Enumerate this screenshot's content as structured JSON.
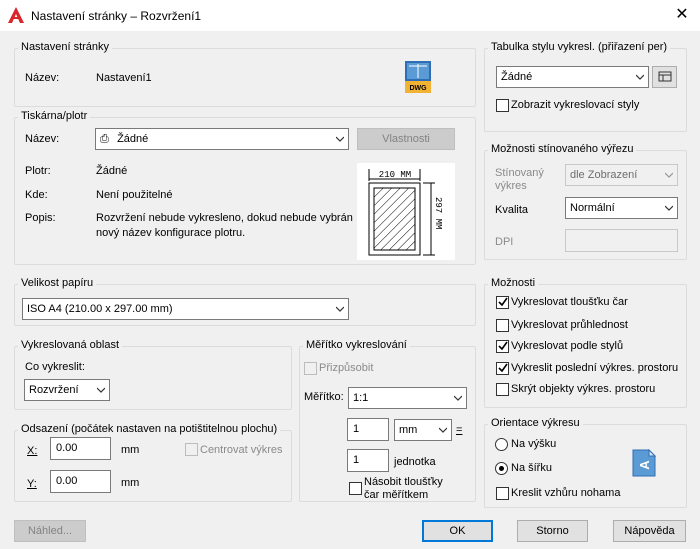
{
  "window": {
    "title": "Nastavení stránky – Rozvržení1",
    "close_glyph": "✕"
  },
  "page_setup": {
    "legend": "Nastavení stránky",
    "name_label": "Název:",
    "name_value": "Nastavení1",
    "dwg_icon_text": "DWG"
  },
  "printer": {
    "legend": "Tiskárna/plotr",
    "name_label": "Název:",
    "name_value": "Žádné",
    "properties_button": "Vlastnosti",
    "plotter_label": "Plotr:",
    "plotter_value": "Žádné",
    "where_label": "Kde:",
    "where_value": "Není použitelné",
    "desc_label": "Popis:",
    "desc_line1": "Rozvržení nebude vykresleno, dokud nebude vybrán",
    "desc_line2": "nový název konfigurace plotru.",
    "preview_width_text": "210 MM",
    "preview_height_text": "297 MM"
  },
  "paper_size": {
    "legend": "Velikost papíru",
    "value": "ISO A4 (210.00 x 297.00 mm)"
  },
  "plot_area": {
    "legend": "Vykreslovaná oblast",
    "what_label": "Co vykreslit:",
    "what_value": "Rozvržení"
  },
  "plot_offset": {
    "legend": "Odsazení (počátek nastaven na potištitelnou plochu)",
    "x_label": "X:",
    "x_value": "0.00",
    "x_unit": "mm",
    "y_label": "Y:",
    "y_value": "0.00",
    "y_unit": "mm",
    "center_label": "Centrovat výkres"
  },
  "plot_scale": {
    "legend": "Měřítko vykreslování",
    "fit_label": "Přizpůsobit",
    "scale_label": "Měřítko:",
    "scale_value": "1:1",
    "mm_value": "1",
    "mm_unit": "mm",
    "equals": "=",
    "unit_value": "1",
    "unit_label": "jednotka",
    "scale_lw_line1": "Násobit tloušťky",
    "scale_lw_line2": "čar měřítkem"
  },
  "plot_style_table": {
    "legend": "Tabulka stylu vykresl. (přiřazení per)",
    "value": "Žádné",
    "display_label": "Zobrazit vykreslovací styly"
  },
  "shaded_viewport": {
    "legend": "Možnosti stínovaného výřezu",
    "shade_label_line1": "Stínovaný",
    "shade_label_line2": "výkres",
    "shade_value": "dle Zobrazení",
    "quality_label": "Kvalita",
    "quality_value": "Normální",
    "dpi_label": "DPI"
  },
  "plot_options": {
    "legend": "Možnosti",
    "items": [
      {
        "label": "Vykreslovat tloušťku čar",
        "checked": true
      },
      {
        "label": "Vykreslovat průhlednost",
        "checked": false
      },
      {
        "label": "Vykreslovat podle stylů",
        "checked": true
      },
      {
        "label": "Vykreslit poslední výkres. prostoru",
        "checked": true
      },
      {
        "label": "Skrýt objekty výkres. prostoru",
        "checked": false
      }
    ]
  },
  "orientation": {
    "legend": "Orientace výkresu",
    "portrait_label": "Na výšku",
    "landscape_label": "Na šířku",
    "upside_down_label": "Kreslit vzhůru nohama",
    "icon_letter": "A"
  },
  "footer": {
    "preview_button": "Náhled...",
    "ok_button": "OK",
    "cancel_button": "Storno",
    "help_button": "Nápověda"
  }
}
